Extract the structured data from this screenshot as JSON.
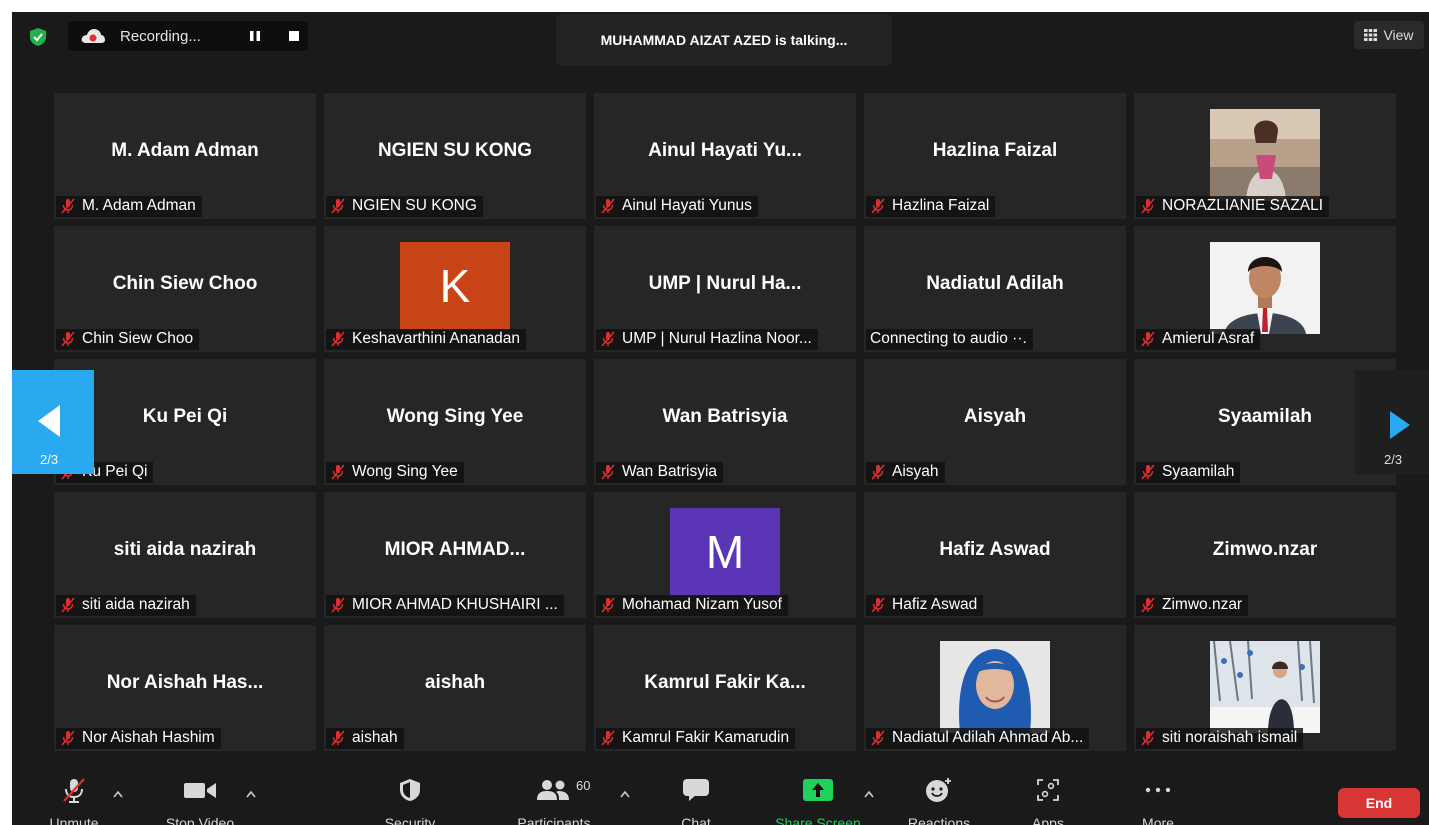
{
  "topbar": {
    "recording_label": "Recording...",
    "talking_banner": "MUHAMMAD AIZAT AZED is talking...",
    "view_label": "View"
  },
  "pager": {
    "left_page": "2/3",
    "right_page": "2/3"
  },
  "tiles": [
    {
      "name": "M. Adam Adman",
      "label": "M. Adam Adman"
    },
    {
      "name": "NGIEN SU KONG",
      "label": "NGIEN SU KONG"
    },
    {
      "name": "Ainul  Hayati  Yu...",
      "label": "Ainul Hayati Yunus"
    },
    {
      "name": "Hazlina Faizal",
      "label": "Hazlina Faizal"
    },
    {
      "name": "",
      "label": "NORAZLIANIE SAZALI",
      "photo": "woman-standing-photo"
    },
    {
      "name": "Chin Siew Choo",
      "label": "Chin Siew Choo"
    },
    {
      "name": "",
      "label": "Keshavarthini Ananadan",
      "avatar_letter": "K",
      "avatar_color": "#c84316"
    },
    {
      "name": "UMP | Nurul  Ha...",
      "label": "UMP | Nurul Hazlina Noor..."
    },
    {
      "name": "Nadiatul Adilah",
      "label": "Connecting to audio ··.",
      "connecting": true
    },
    {
      "name": "",
      "label": "Amierul Asraf",
      "photo": "man-suit-photo"
    },
    {
      "name": "Ku Pei Qi",
      "label": "Ku Pei Qi"
    },
    {
      "name": "Wong Sing Yee",
      "label": "Wong Sing Yee"
    },
    {
      "name": "Wan Batrisyia",
      "label": "Wan Batrisyia"
    },
    {
      "name": "Aisyah",
      "label": "Aisyah"
    },
    {
      "name": "Syaamilah",
      "label": "Syaamilah"
    },
    {
      "name": "siti aida nazirah",
      "label": "siti aida nazirah"
    },
    {
      "name": "MIOR  AHMAD...",
      "label": "MIOR AHMAD KHUSHAIRI ..."
    },
    {
      "name": "",
      "label": "Mohamad Nizam Yusof",
      "avatar_letter": "M",
      "avatar_color": "#5a36b6"
    },
    {
      "name": "Hafiz Aswad",
      "label": "Hafiz Aswad"
    },
    {
      "name": "Zimwo.nzar",
      "label": "Zimwo.nzar"
    },
    {
      "name": "Nor Aishah Has...",
      "label": "Nor Aishah Hashim"
    },
    {
      "name": "aishah",
      "label": "aishah"
    },
    {
      "name": "Kamrul  Fakir  Ka...",
      "label": "Kamrul Fakir Kamarudin"
    },
    {
      "name": "",
      "label": "Nadiatul Adilah Ahmad Ab...",
      "photo": "woman-hijab-photo"
    },
    {
      "name": "",
      "label": "siti noraishah ismail",
      "photo": "person-snow-photo"
    }
  ],
  "toolbar": {
    "unmute": "Unmute",
    "stop_video": "Stop Video",
    "security": "Security",
    "participants": "Participants",
    "participant_count": "60",
    "chat": "Chat",
    "share_screen": "Share Screen",
    "reactions": "Reactions",
    "apps": "Apps",
    "more": "More",
    "end": "End"
  },
  "colors": {
    "share_green": "#1fd05a",
    "end_red": "#d83535",
    "pager_blue": "#2aa8f0",
    "muted_red": "#e02d2d"
  }
}
